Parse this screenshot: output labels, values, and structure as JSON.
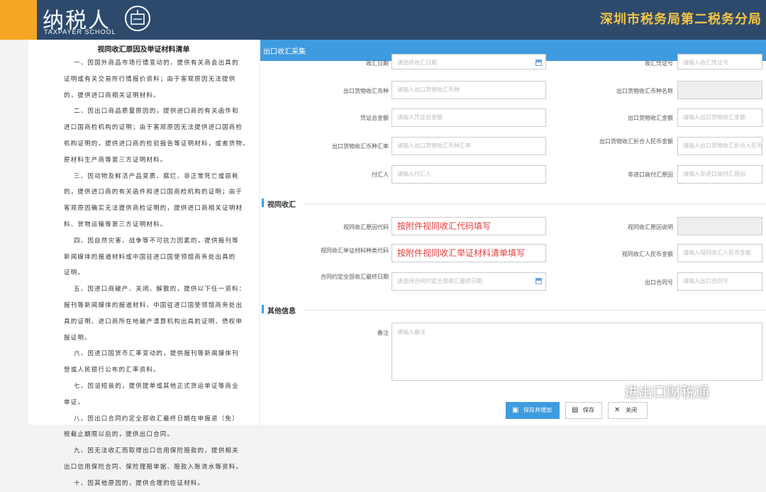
{
  "header": {
    "logo_main": "纳税人",
    "logo_sub": "TAXPAYER SCHOOL",
    "bureau": "深圳市税务局第二税务分局"
  },
  "document": {
    "title": "视同收汇原因及举证材料清单",
    "lines": [
      "一、因国外商品市场行情变动的，提供有关商会出具的",
      "证明或有关交易所行情报价资料；由于客观原因无法提供",
      "的，提供进口商相关证明材料。",
      "二、因出口商品质量原因的，提供进口商的有关函件和",
      "进口国商检机构的证明；由于客观原因无法提供进口国商检",
      "机构证明的，提供进口商的检验报告等证明材料，或者货物、",
      "原材料生产商等第三方证明材料。",
      "三、因动物及鲜活产品变质、腐烂、非正常死亡或损耗",
      "的，提供进口商的有关函件和进口国商检机构的证明；由于",
      "客观原因确实无法提供商检证明的，提供进口商相关证明材",
      "料、货物运输等第三方证明材料。",
      "四、因自然灾害、战争等不可抗力因素的，提供报刊等",
      "新闻媒体的报道材料或中国驻进口国使领馆商务处出具的",
      "证明。",
      "五、因进口商破产、关闭、解散的，提供以下任一资料：",
      "报刊等新闻媒体的报道材料、中国驻进口国使领馆商务处出",
      "具的证明、进口商所在地破产清算机构出具的证明、债权申",
      "报证明。",
      "六、因进口国货币汇率变动的，提供报刊等新闻媒体刊",
      "登或人民银行公布的汇率资料。",
      "七、因溢短装的，提供提单或其他正式货运单证等商业",
      "单证。",
      "八、因出口合同约定全部收汇最终日期在申报退（免）",
      "税截止期限以后的，提供出口合同。",
      "九、因无法收汇而取得出口信用保险赔款的，提供相关",
      "出口信用保险合同、保险理赔单据、赔款入账流水等资料。",
      "十、因其他原因的，提供合理的佐证材料。"
    ]
  },
  "form": {
    "title": "出口收汇采集",
    "fields": {
      "a_label": "收汇日期",
      "a_ph": "请选择收汇日期",
      "b_label": "收汇凭证号",
      "b_ph": "请输入收汇凭证号",
      "c_label": "出口货物收汇币种",
      "c_ph": "请输入出口货物收汇币种",
      "d_label": "出口货物收汇币种名称",
      "e_label": "凭证总金额",
      "e_ph": "请输入凭证总金额",
      "f_label": "出口货物收汇金额",
      "f_ph": "请输入出口货物收汇金额",
      "g_label": "出口货物收汇币种汇率",
      "g_ph": "请输入出口货物收汇币种汇率",
      "h_label": "出口货物收汇折合人民币金额",
      "h_ph": "请输入出口货物收汇折合人民币金额",
      "i_label": "付汇人",
      "i_ph": "请输入付汇人",
      "j_label": "非进口商付汇原因",
      "j_ph": "请输入非进口商付汇原因"
    },
    "section_deemed": "视同收汇",
    "deemed": {
      "k_label": "视同收汇原因代码",
      "k_value": "按附件视同收汇代码填写",
      "l_label": "视同收汇原因说明",
      "m_label": "视同收汇举证材料种类代码",
      "m_value": "按附件视同收汇举证材料清单填写",
      "n_label": "视同收汇人民币金额",
      "n_ph": "请输入视同收汇人民币金额",
      "o_label": "合同约定全部收汇最终日期",
      "o_ph": "请选择合同约定全部收汇最终日期",
      "p_label": "出口合同号",
      "p_ph": "请输入出口合同号"
    },
    "section_other": "其他信息",
    "other": {
      "q_label": "备注",
      "q_ph": "请输入备注"
    },
    "buttons": {
      "save_add": "保存并增加",
      "save": "保存",
      "close": "关闭"
    }
  },
  "watermark": {
    "text": "进出口财税通"
  }
}
